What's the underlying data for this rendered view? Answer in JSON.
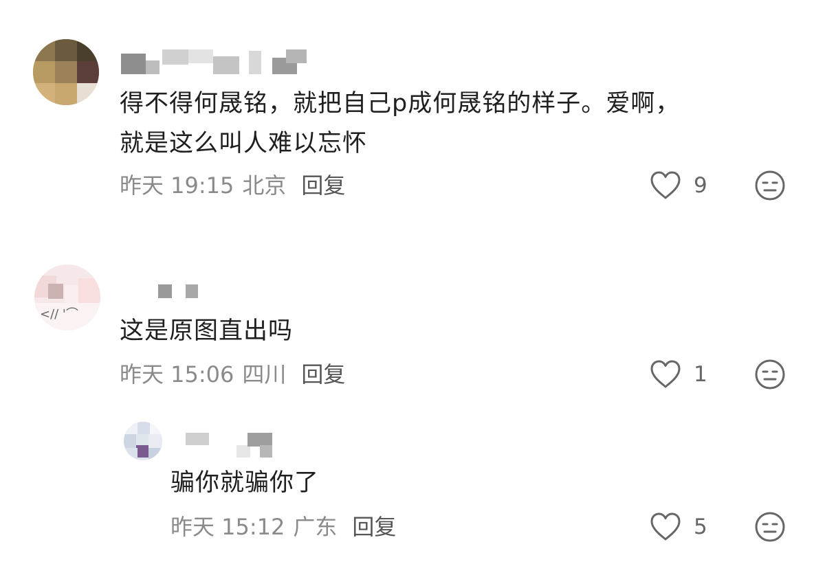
{
  "comments": [
    {
      "text": "得不得何晟铭，就把自己p成何晟铭的样子。爱啊，\n就是这么叫人难以忘怀",
      "time": "昨天 19:15",
      "location": "北京",
      "reply_label": "回复",
      "likes": "9",
      "like_icon": "heart-outline-icon",
      "reaction_icon": "meh-face-icon"
    },
    {
      "text": "这是原图直出吗",
      "time": "昨天 15:06",
      "location": "四川",
      "reply_label": "回复",
      "likes": "1",
      "like_icon": "heart-outline-icon",
      "reaction_icon": "meh-face-icon"
    }
  ],
  "replies": [
    {
      "text": "骗你就骗你了",
      "time": "昨天 15:12",
      "location": "广东",
      "reply_label": "回复",
      "likes": "5",
      "like_icon": "heart-outline-icon",
      "reaction_icon": "meh-face-icon"
    }
  ],
  "colors": {
    "text": "#1f1f1f",
    "meta": "#8a8a8a",
    "icon": "#666666"
  }
}
